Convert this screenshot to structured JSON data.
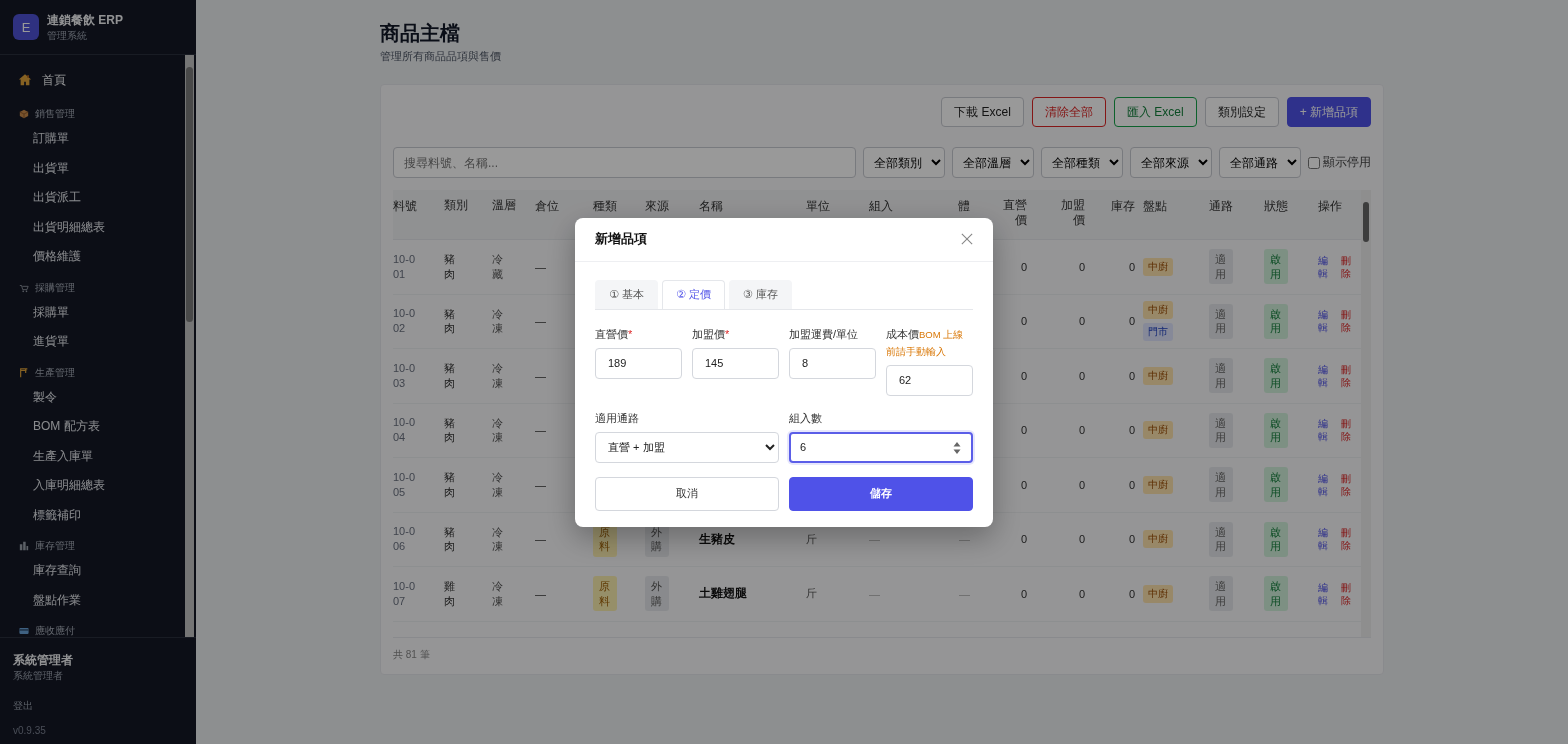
{
  "sidebar": {
    "brand": {
      "logo": "E",
      "title": "連鎖餐飲 ERP",
      "subtitle": "管理系統"
    },
    "nav": [
      {
        "kind": "link",
        "label": "首頁"
      },
      {
        "kind": "group",
        "label": "銷售管理",
        "children": [
          {
            "label": "訂購單"
          },
          {
            "label": "出貨單"
          },
          {
            "label": "出貨派工"
          },
          {
            "label": "出貨明細總表"
          },
          {
            "label": "價格維護"
          }
        ]
      },
      {
        "kind": "group",
        "label": "採購管理",
        "children": [
          {
            "label": "採購單"
          },
          {
            "label": "進貨單"
          }
        ]
      },
      {
        "kind": "group",
        "label": "生產管理",
        "children": [
          {
            "label": "製令"
          },
          {
            "label": "BOM 配方表"
          },
          {
            "label": "生產入庫單"
          },
          {
            "label": "入庫明細總表"
          },
          {
            "label": "標籤補印"
          }
        ]
      },
      {
        "kind": "group",
        "label": "庫存管理",
        "children": [
          {
            "label": "庫存查詢"
          },
          {
            "label": "盤點作業"
          }
        ]
      },
      {
        "kind": "group",
        "label": "應收應付"
      }
    ],
    "user": {
      "name": "系統管理者",
      "role": "系統管理者"
    },
    "logout": "登出",
    "version": "v0.9.35"
  },
  "page": {
    "title": "商品主檔",
    "subtitle": "管理所有商品品項與售價"
  },
  "toolbar": {
    "buttons": [
      {
        "label": "下載 Excel",
        "kind": "default"
      },
      {
        "label": "清除全部",
        "kind": "danger"
      },
      {
        "label": "匯入 Excel",
        "kind": "success"
      },
      {
        "label": "類別設定",
        "kind": "default"
      },
      {
        "label": "+ 新增品項",
        "kind": "primary"
      }
    ]
  },
  "filters": {
    "search": {
      "placeholder": "搜尋料號、名稱..."
    },
    "selects": [
      "全部類別",
      "全部溫層",
      "全部種類",
      "全部來源",
      "全部通路"
    ],
    "show_disabled": {
      "label": "顯示停用",
      "checked": false
    }
  },
  "table": {
    "columns": [
      "料號",
      "類別",
      "溫層",
      "倉位",
      "種類",
      "來源",
      "名稱",
      "單位",
      "組入",
      "體",
      "直營價",
      "加盟價",
      "庫存",
      "盤點",
      "通路",
      "狀態",
      "操作"
    ],
    "rows": [
      {
        "code": "10-001",
        "category": "豬肉",
        "temp": "冷藏",
        "bin": "—",
        "direct_price": "0",
        "franchise_price": "0",
        "stock": "0",
        "count_tags": [
          {
            "label": "中廚",
            "kind": "kitchen"
          }
        ],
        "channel": "適用",
        "status": "啟用",
        "actions": [
          "編輯",
          "刪除"
        ]
      },
      {
        "code": "10-002",
        "category": "豬肉",
        "temp": "冷凍",
        "bin": "—",
        "direct_price": "0",
        "franchise_price": "0",
        "stock": "0",
        "count_tags": [
          {
            "label": "中廚",
            "kind": "kitchen"
          },
          {
            "label": "門市",
            "kind": "store"
          }
        ],
        "channel": "適用",
        "status": "啟用",
        "actions": [
          "編輯",
          "刪除"
        ]
      },
      {
        "code": "10-003",
        "category": "豬肉",
        "temp": "冷凍",
        "bin": "—",
        "direct_price": "0",
        "franchise_price": "0",
        "stock": "0",
        "count_tags": [
          {
            "label": "中廚",
            "kind": "kitchen"
          }
        ],
        "channel": "適用",
        "status": "啟用",
        "actions": [
          "編輯",
          "刪除"
        ]
      },
      {
        "code": "10-004",
        "category": "豬肉",
        "temp": "冷凍",
        "bin": "—",
        "direct_price": "0",
        "franchise_price": "0",
        "stock": "0",
        "count_tags": [
          {
            "label": "中廚",
            "kind": "kitchen"
          }
        ],
        "channel": "適用",
        "status": "啟用",
        "actions": [
          "編輯",
          "刪除"
        ]
      },
      {
        "code": "10-005",
        "category": "豬肉",
        "temp": "冷凍",
        "bin": "—",
        "direct_price": "0",
        "franchise_price": "0",
        "stock": "0",
        "count_tags": [
          {
            "label": "中廚",
            "kind": "kitchen"
          }
        ],
        "channel": "適用",
        "status": "啟用",
        "actions": [
          "編輯",
          "刪除"
        ]
      },
      {
        "code": "10-006",
        "category": "豬肉",
        "temp": "冷凍",
        "bin": "—",
        "material": "原料",
        "source": "外購",
        "name": "生豬皮",
        "unit": "斤",
        "pack": "—",
        "volume": "—",
        "direct_price": "0",
        "franchise_price": "0",
        "stock": "0",
        "count_tags": [
          {
            "label": "中廚",
            "kind": "kitchen"
          }
        ],
        "channel": "適用",
        "status": "啟用",
        "actions": [
          "編輯",
          "刪除"
        ]
      },
      {
        "code": "10-007",
        "category": "雞肉",
        "temp": "冷凍",
        "bin": "—",
        "material": "原料",
        "source": "外購",
        "name": "土雞翅腿",
        "unit": "斤",
        "pack": "—",
        "volume": "—",
        "direct_price": "0",
        "franchise_price": "0",
        "stock": "0",
        "count_tags": [
          {
            "label": "中廚",
            "kind": "kitchen"
          }
        ],
        "channel": "適用",
        "status": "啟用",
        "actions": [
          "編輯",
          "刪除"
        ]
      }
    ],
    "footer": "共 81 筆"
  },
  "modal": {
    "title": "新增品項",
    "tabs": [
      {
        "label": "① 基本",
        "selected": false
      },
      {
        "label": "② 定價",
        "selected": true
      },
      {
        "label": "③ 庫存",
        "selected": false
      }
    ],
    "price_fields": [
      {
        "label": "直營價",
        "mark": "*",
        "value": "189",
        "focused": false
      },
      {
        "label": "加盟價",
        "mark": "*",
        "value": "145",
        "focused": false
      },
      {
        "label": "加盟運費/單位",
        "value": "8",
        "focused": false
      },
      {
        "label": "成本價",
        "hint": "BOM 上線前請手動輸入",
        "value": "62",
        "focused": false
      }
    ],
    "channel_field": {
      "label": "適用通路",
      "value": "直營 + 加盟",
      "focused": false
    },
    "pack_field": {
      "label": "組入數",
      "value": "6",
      "focused": true
    },
    "buttons": [
      {
        "label": "取消",
        "kind": "default"
      },
      {
        "label": "儲存",
        "kind": "primary"
      }
    ]
  }
}
